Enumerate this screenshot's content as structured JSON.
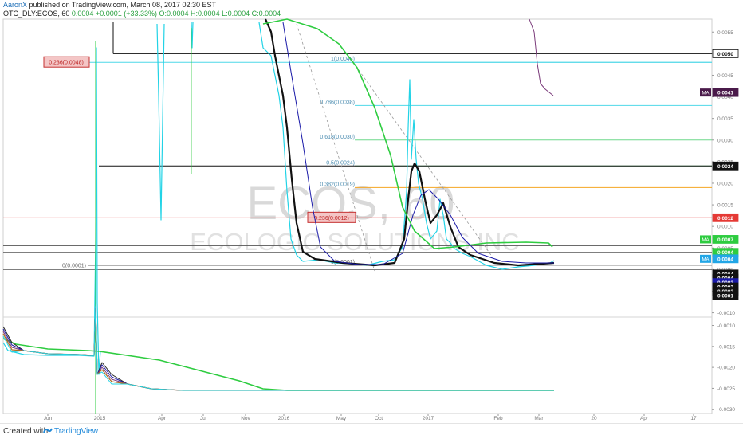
{
  "header": {
    "author": "AaronX",
    "published": "published on TradingView.com, March 08, 2017 02:30 EST",
    "symbol_line": "OTC_DLY:ECOS, 60",
    "price": "0.0004",
    "change": "+0.0001 (+33.33%)",
    "ohlc": "O:0.0004 H:0.0004 L:0.0004 C:0.0004"
  },
  "footer": {
    "created_with": "Created with",
    "brand": "TradingView"
  },
  "watermark": {
    "symbol": "ECOS, 60",
    "company": "ECOLOGIC SOLUTIONS INC"
  },
  "colors": {
    "price": "#22d3e6",
    "ma_green": "#2ecc40",
    "ma_black": "#111111",
    "ma_navy": "#1a1aa8",
    "ma_purple": "#7a3a7a",
    "fib_cyan": "#4fd8e8",
    "fib_red": "#e85050",
    "fib_orange": "#f5a623",
    "fib_grey": "#888888",
    "fib_green": "#6fd88c"
  },
  "chart_data": [
    {
      "type": "line",
      "pane": "price",
      "x_ticks": [
        "Jun",
        "2015",
        "Apr",
        "Jul",
        "Nov",
        "2016",
        "May",
        "Oct",
        "2017",
        "Feb",
        "Mar",
        "20",
        "Apr",
        "17"
      ],
      "y_axis": [
        0.0055,
        0.005,
        0.0045,
        0.004,
        0.0035,
        0.003,
        0.0025,
        0.002,
        0.0015,
        0.001,
        0.0005,
        0.0,
        -0.0005,
        -0.001
      ],
      "ylim": [
        -0.0011,
        0.0058
      ],
      "fib_levels": [
        {
          "label": "1(0.0048)",
          "value": 0.0048
        },
        {
          "label": "0.786(0.0038)",
          "value": 0.0038
        },
        {
          "label": "0.618(0.0030)",
          "value": 0.003
        },
        {
          "label": "0.5(0.0024)",
          "value": 0.0024
        },
        {
          "label": "0.382(0.0019)",
          "value": 0.0019
        },
        {
          "label": "0.236(0.0012)",
          "value": 0.0012
        },
        {
          "label": "0(0.0001)",
          "value": 0.0001
        },
        {
          "label": "0.236(0.0048)",
          "value": 0.0048
        },
        {
          "label": "0(0.0001)",
          "value": 0.0001
        }
      ],
      "price_labels": [
        {
          "text": "0.0050",
          "value": 0.005,
          "bg": "#ffffff",
          "fg": "#111111",
          "border": "#111111"
        },
        {
          "text": "0.0041",
          "value": 0.0041,
          "bg": "#4a1a4a",
          "fg": "#ffffff",
          "tag": "MA"
        },
        {
          "text": "0.0024",
          "value": 0.0024,
          "bg": "#111111",
          "fg": "#ffffff"
        },
        {
          "text": "0.0012",
          "value": 0.0012,
          "bg": "#e53935",
          "fg": "#ffffff"
        },
        {
          "text": "0.0007",
          "value": 0.0007,
          "bg": "#2ecc40",
          "fg": "#ffffff",
          "tag": "MA"
        },
        {
          "text": "0.0004",
          "value": 0.0004,
          "bg": "#2ecc40",
          "fg": "#ffffff"
        },
        {
          "text": "0.0004",
          "value": 0.00025,
          "bg": "#22a6e6",
          "fg": "#ffffff",
          "tag": "MA"
        },
        {
          "text": "0.0004",
          "value": -0.0001,
          "bg": "#111111",
          "fg": "#ffffff"
        },
        {
          "text": "0.0004",
          "value": -0.0002,
          "bg": "#111111",
          "fg": "#ffffff"
        },
        {
          "text": "0.0003",
          "value": -0.0003,
          "bg": "#1a1aa8",
          "fg": "#ffffff"
        },
        {
          "text": "0.0003",
          "value": -0.0004,
          "bg": "#111111",
          "fg": "#ffffff"
        },
        {
          "text": "0.0002",
          "value": -0.0005,
          "bg": "#111111",
          "fg": "#ffffff"
        },
        {
          "text": "0.0001",
          "value": -0.0006,
          "bg": "#111111",
          "fg": "#ffffff"
        }
      ]
    },
    {
      "type": "line",
      "pane": "indicator",
      "y_axis": [
        -0.001,
        -0.0015,
        -0.002,
        -0.0025,
        -0.003
      ],
      "ylim": [
        -0.0031,
        -0.0008
      ]
    }
  ]
}
